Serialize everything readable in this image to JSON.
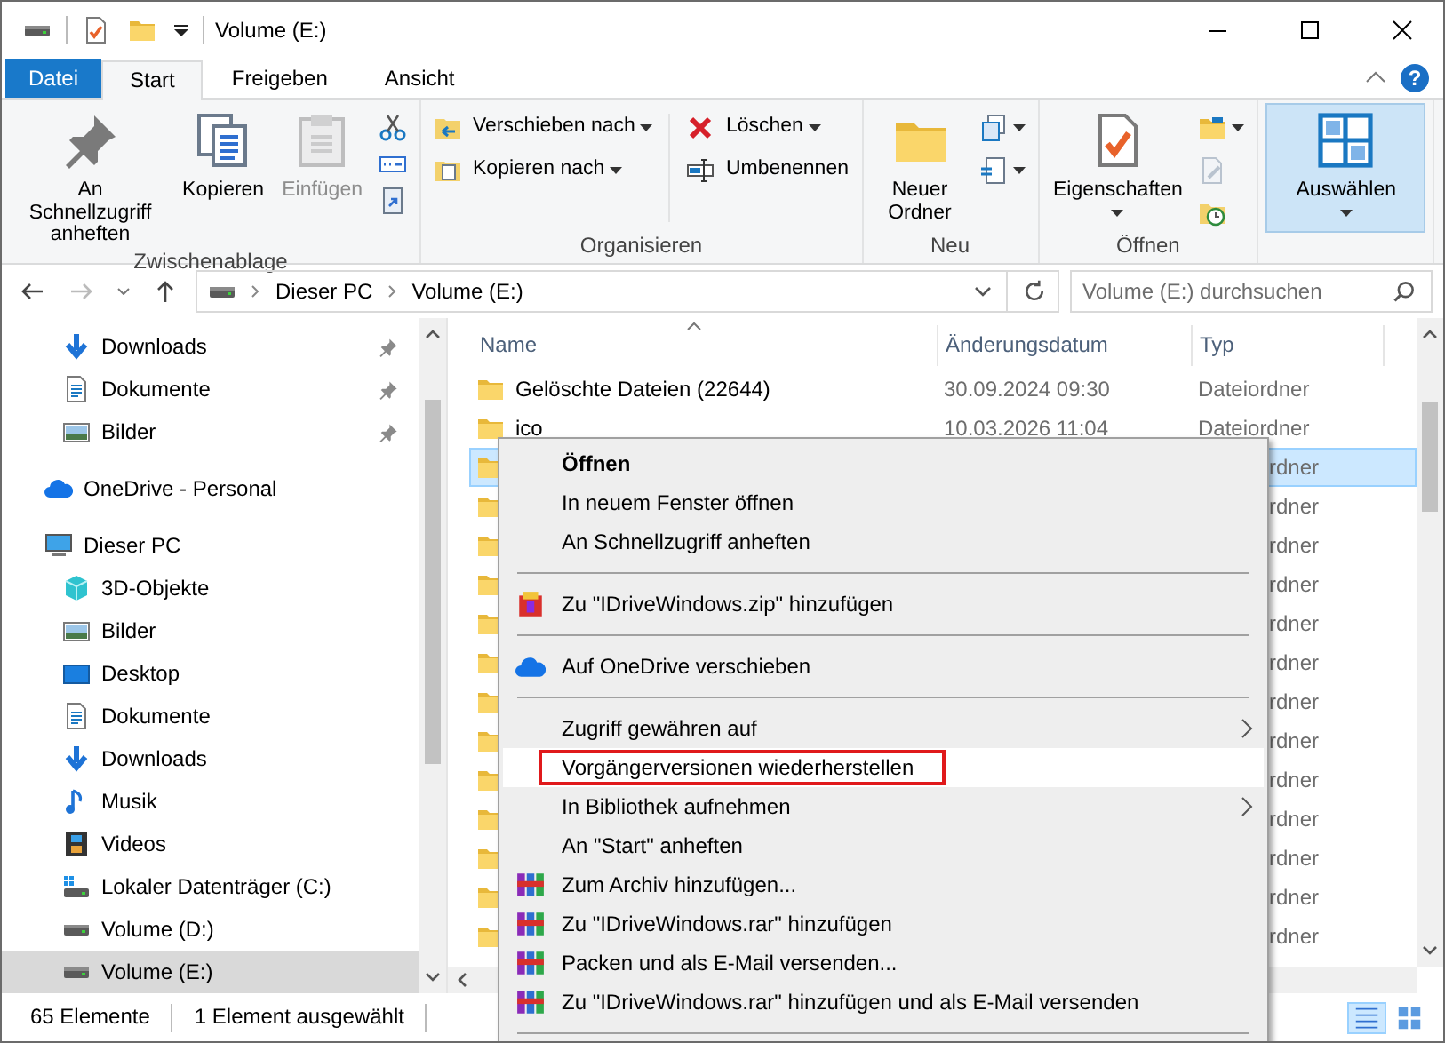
{
  "window": {
    "title": "Volume (E:)"
  },
  "tabs": [
    {
      "label": "Datei",
      "kind": "file",
      "selected": false
    },
    {
      "label": "Start",
      "kind": "tab",
      "selected": true
    },
    {
      "label": "Freigeben",
      "kind": "tab",
      "selected": false
    },
    {
      "label": "Ansicht",
      "kind": "tab",
      "selected": false
    }
  ],
  "help": "?",
  "ribbon_groups": [
    {
      "label": "Zwischenablage",
      "items": [
        {
          "kind": "large",
          "label": "An Schnellzugriff anheften",
          "disabled": false,
          "dropdown": false,
          "selected": false
        },
        {
          "kind": "large",
          "label": "Kopieren",
          "disabled": false,
          "dropdown": false,
          "selected": false
        },
        {
          "kind": "large",
          "label": "Einfügen",
          "disabled": true,
          "dropdown": false,
          "selected": false
        },
        {
          "kind": "stack",
          "entries": [
            {
              "dropdown": false
            },
            {
              "dropdown": false
            },
            {
              "dropdown": false
            }
          ]
        }
      ]
    },
    {
      "label": "Organisieren",
      "items": [
        {
          "kind": "stack",
          "entries": [
            {
              "label": "Verschieben nach",
              "dropdown": true
            },
            {
              "label": "Kopieren nach",
              "dropdown": true
            }
          ]
        },
        {
          "kind": "stack",
          "entries": [
            {
              "label": "Löschen",
              "dropdown": true
            },
            {
              "label": "Umbenennen",
              "dropdown": false
            }
          ]
        }
      ]
    },
    {
      "label": "Neu",
      "items": [
        {
          "kind": "large",
          "label": "Neuer Ordner",
          "disabled": false,
          "dropdown": false,
          "selected": false
        },
        {
          "kind": "stack",
          "entries": [
            {
              "dropdown": true
            },
            {
              "dropdown": true
            }
          ]
        }
      ]
    },
    {
      "label": "Öffnen",
      "items": [
        {
          "kind": "large",
          "label": "Eigenschaften",
          "disabled": false,
          "dropdown": true,
          "selected": false
        },
        {
          "kind": "stack",
          "entries": [
            {
              "dropdown": true
            },
            {
              "dropdown": false
            },
            {
              "dropdown": false
            }
          ]
        }
      ]
    },
    {
      "items": [
        {
          "kind": "large",
          "label": "Auswählen",
          "disabled": false,
          "dropdown": true,
          "selected": true
        }
      ]
    }
  ],
  "address": {
    "breadcrumbs": [
      "Dieser PC",
      "Volume (E:)"
    ],
    "search_placeholder": "Volume (E:) durchsuchen"
  },
  "nav": {
    "quick_access_items": [
      {
        "label": "Downloads",
        "kind": "download",
        "pinned": true,
        "selected": false
      },
      {
        "label": "Dokumente",
        "kind": "document",
        "pinned": true,
        "selected": false
      },
      {
        "label": "Bilder",
        "kind": "pictures",
        "pinned": true,
        "selected": false
      }
    ],
    "roots": [
      {
        "label": "OneDrive - Personal",
        "kind": "cloud",
        "selected": false
      },
      {
        "label": "Dieser PC",
        "kind": "pc",
        "selected": false,
        "children": [
          {
            "label": "3D-Objekte",
            "kind": "cube",
            "selected": false
          },
          {
            "label": "Bilder",
            "kind": "pictures",
            "selected": false
          },
          {
            "label": "Desktop",
            "kind": "desktop",
            "selected": false
          },
          {
            "label": "Dokumente",
            "kind": "document",
            "selected": false
          },
          {
            "label": "Downloads",
            "kind": "download",
            "selected": false
          },
          {
            "label": "Musik",
            "kind": "music",
            "selected": false
          },
          {
            "label": "Videos",
            "kind": "film",
            "selected": false
          },
          {
            "label": "Lokaler Datenträger (C:)",
            "kind": "windrive",
            "selected": false
          },
          {
            "label": "Volume (D:)",
            "kind": "drive",
            "selected": false
          },
          {
            "label": "Volume (E:)",
            "kind": "drive",
            "selected": true
          }
        ]
      }
    ]
  },
  "files": {
    "columns": [
      "Name",
      "Änderungsdatum",
      "Typ"
    ],
    "rows": [
      {
        "name": "Gelöschte Dateien (22644)",
        "date": "30.09.2024 09:30",
        "type": "Dateiordner",
        "selected": false
      },
      {
        "name": "ico",
        "date": "10.03.2026 11:04",
        "type": "Dateiordner",
        "selected": false
      },
      {
        "type": "rdner",
        "selected": true
      },
      {
        "type": "rdner",
        "selected": false
      },
      {
        "type": "rdner",
        "selected": false
      },
      {
        "type": "rdner",
        "selected": false
      },
      {
        "type": "rdner",
        "selected": false
      },
      {
        "type": "rdner",
        "selected": false
      },
      {
        "type": "rdner",
        "selected": false
      },
      {
        "type": "rdner",
        "selected": false
      },
      {
        "type": "rdner",
        "selected": false
      },
      {
        "type": "rdner",
        "selected": false
      },
      {
        "type": "rdner",
        "selected": false
      },
      {
        "type": "rdner",
        "selected": false
      },
      {
        "type": "rdner",
        "selected": false
      }
    ]
  },
  "context_menu": [
    {
      "kind": "plain",
      "label": "Öffnen",
      "bold": true,
      "submenu": false,
      "hovered": false,
      "annotated": false
    },
    {
      "kind": "plain",
      "label": "In neuem Fenster öffnen",
      "bold": false,
      "submenu": false,
      "hovered": false,
      "annotated": false
    },
    {
      "kind": "plain",
      "label": "An Schnellzugriff anheften",
      "bold": false,
      "submenu": false,
      "hovered": false,
      "annotated": false
    },
    {
      "kind": "separator"
    },
    {
      "kind": "zip",
      "label": "Zu \"IDriveWindows.zip\" hinzufügen",
      "bold": false,
      "submenu": false,
      "hovered": false,
      "annotated": false
    },
    {
      "kind": "separator"
    },
    {
      "kind": "cloud",
      "label": "Auf OneDrive verschieben",
      "bold": false,
      "submenu": false,
      "hovered": false,
      "annotated": false
    },
    {
      "kind": "separator"
    },
    {
      "kind": "plain",
      "label": "Zugriff gewähren auf",
      "bold": false,
      "submenu": true,
      "hovered": false,
      "annotated": false
    },
    {
      "kind": "plain",
      "label": "Vorgängerversionen wiederherstellen",
      "bold": false,
      "submenu": false,
      "hovered": true,
      "annotated": true
    },
    {
      "kind": "plain",
      "label": "In Bibliothek aufnehmen",
      "bold": false,
      "submenu": true,
      "hovered": false,
      "annotated": false
    },
    {
      "kind": "plain",
      "label": "An \"Start\" anheften",
      "bold": false,
      "submenu": false,
      "hovered": false,
      "annotated": false
    },
    {
      "kind": "rar",
      "label": "Zum Archiv hinzufügen...",
      "bold": false,
      "submenu": false,
      "hovered": false,
      "annotated": false
    },
    {
      "kind": "rar",
      "label": "Zu \"IDriveWindows.rar\" hinzufügen",
      "bold": false,
      "submenu": false,
      "hovered": false,
      "annotated": false
    },
    {
      "kind": "rar",
      "label": "Packen und als E-Mail versenden...",
      "bold": false,
      "submenu": false,
      "hovered": false,
      "annotated": false
    },
    {
      "kind": "rar",
      "label": "Zu \"IDriveWindows.rar\" hinzufügen und als E-Mail versenden",
      "bold": false,
      "submenu": false,
      "hovered": false,
      "annotated": false
    },
    {
      "kind": "separator"
    }
  ],
  "status_bar": {
    "count": "65 Elemente",
    "selection": "1 Element ausgewählt",
    "views": [
      {
        "kind": "details",
        "selected": true
      },
      {
        "kind": "tiles",
        "selected": false
      }
    ]
  }
}
